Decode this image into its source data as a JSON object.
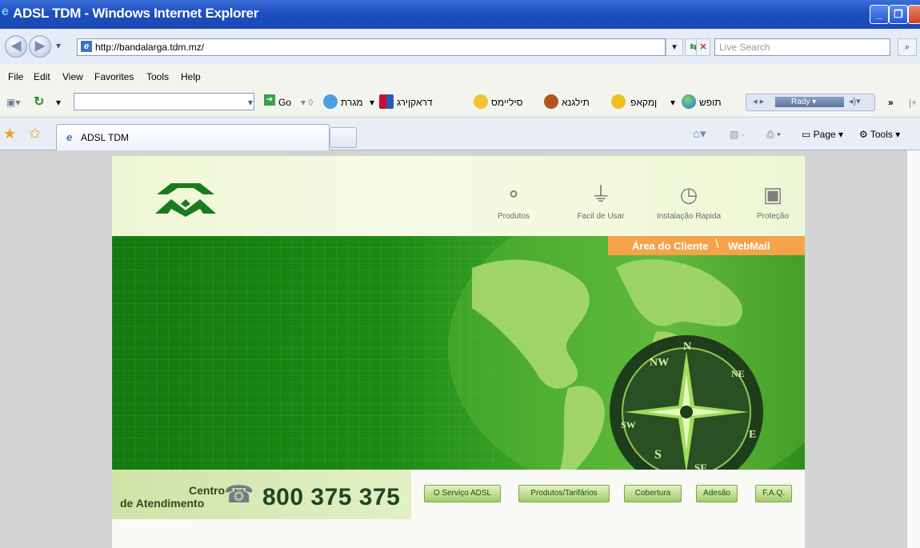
{
  "window": {
    "title": "ADSL TDM - Windows Internet Explorer",
    "minimize": "_",
    "maximize": "❐",
    "close": "✕"
  },
  "addressbar": {
    "back": "◀",
    "forward": "▶",
    "dropdown": "▾",
    "url": "http://bandalarga.tdm.mz/",
    "refresh": "⇆",
    "stop": "✕",
    "search_placeholder": "Live Search",
    "search_icon": "search-icon"
  },
  "menubar": {
    "items": [
      "File",
      "Edit",
      "View",
      "Favorites",
      "Tools",
      "Help"
    ]
  },
  "toolbar": {
    "go_label": "Go",
    "links": [
      "מגרת",
      "דראקןירג",
      "סיליימס",
      "תילגנא",
      "ןמקאפ",
      "תופש"
    ],
    "rady_label": "Rady",
    "more": "»"
  },
  "tabs": {
    "active_label": "ADSL TDM",
    "page_label": "Page",
    "tools_label": "Tools"
  },
  "site": {
    "nav": [
      {
        "label": "Produtos",
        "icon": "coins-icon"
      },
      {
        "label": "Facil de Usar",
        "icon": "plug-icon"
      },
      {
        "label": "Instalação Rapida",
        "icon": "clock-icon"
      },
      {
        "label": "Proteção",
        "icon": "lock-icon"
      }
    ],
    "client_area": "Área do Cliente",
    "webmail": "WebMail",
    "centro_line1": "Centro",
    "centro_line2": "de Atendimento",
    "phone": "800 375 375",
    "buttons": [
      "O Serviço ADSL",
      "Produtos/Tarifários",
      "Cobertura",
      "Adesão",
      "F.A.Q."
    ],
    "compass_letters": [
      "NW",
      "N",
      "NE",
      "E",
      "SE",
      "S",
      "SW"
    ]
  },
  "colors": {
    "titlebar": "#1e4fc0",
    "hero_green": "#1b8a13",
    "client_bar": "#f5a24b",
    "header_bg": "#eef7d4"
  }
}
